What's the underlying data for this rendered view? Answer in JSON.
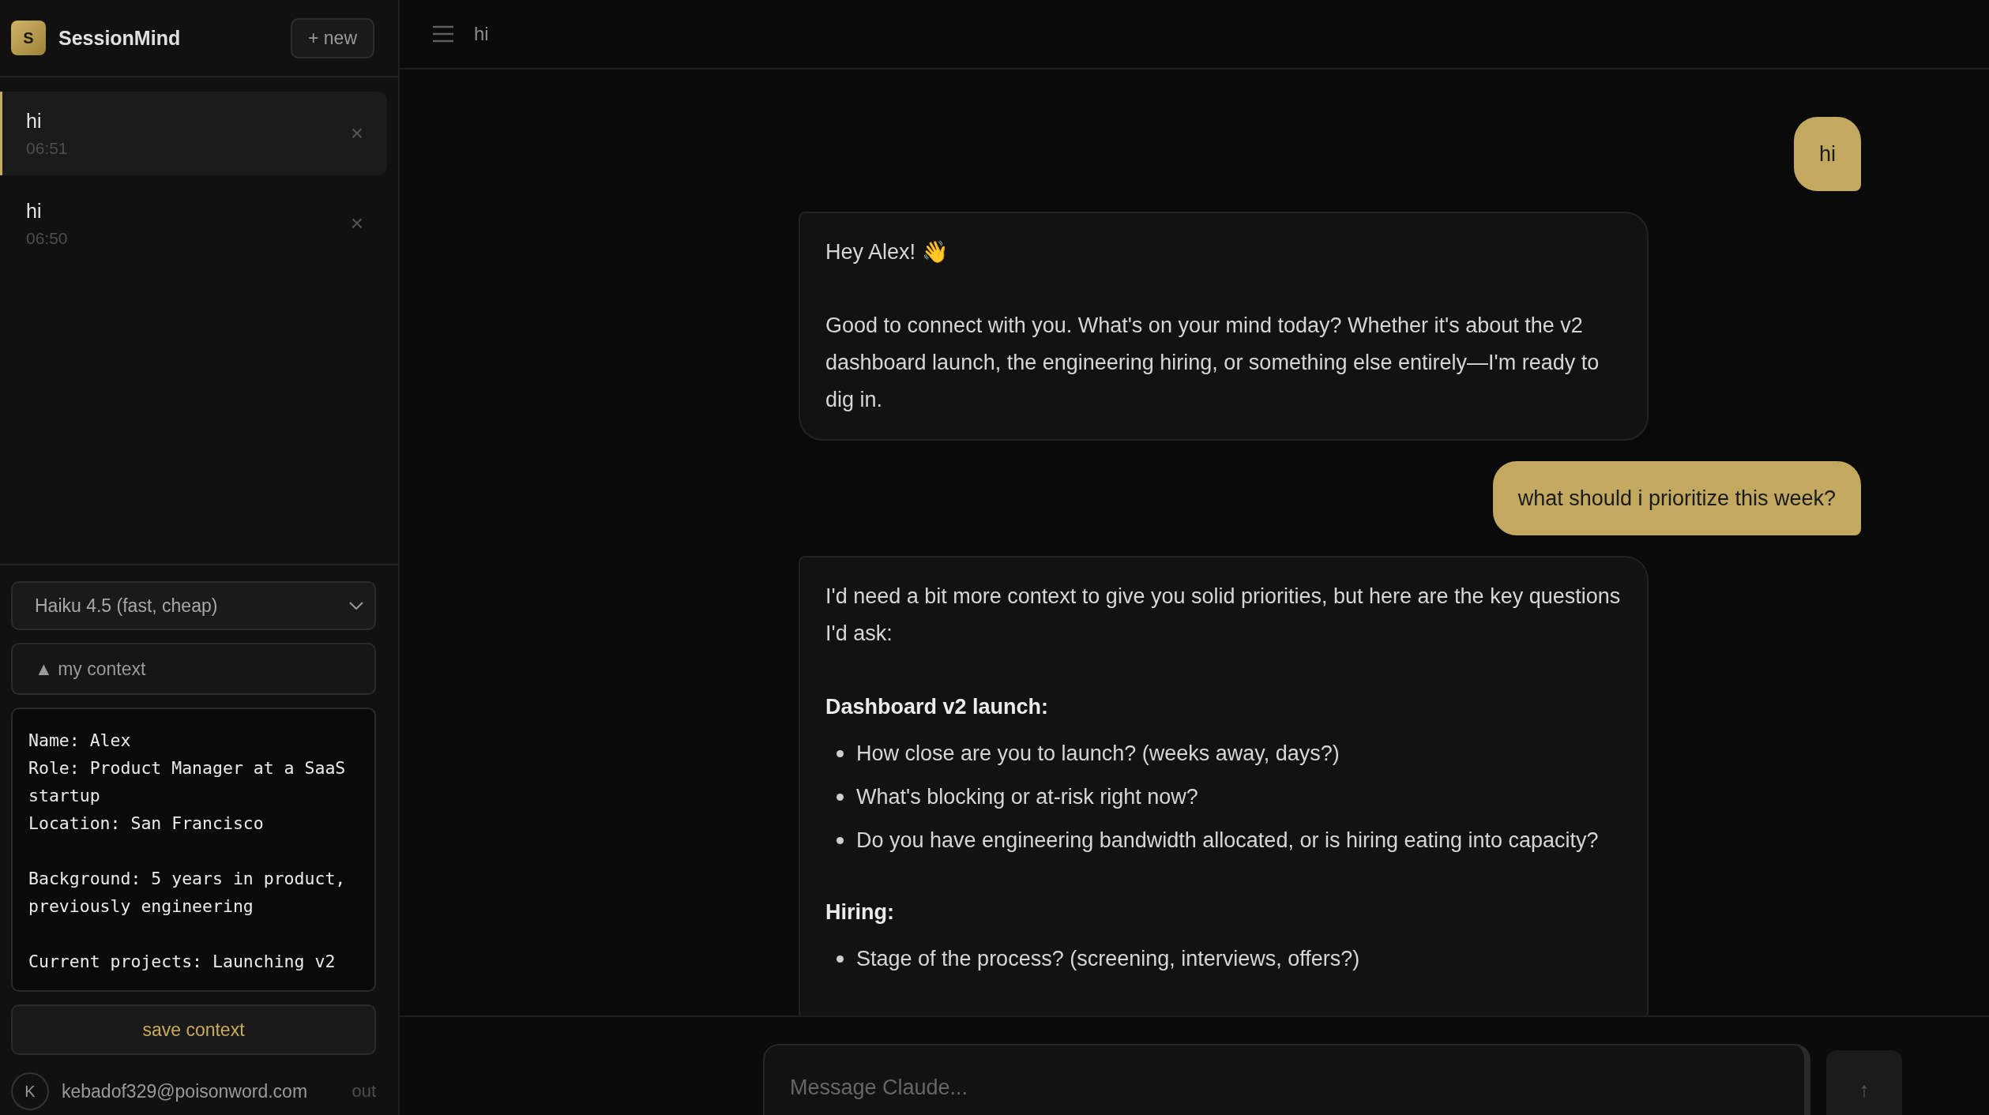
{
  "app": {
    "logo_letter": "S",
    "name": "SessionMind",
    "new_button": "+ new"
  },
  "sessions": [
    {
      "title": "hi",
      "time": "06:51",
      "selected": true,
      "close": "×"
    },
    {
      "title": "hi",
      "time": "06:50",
      "selected": false,
      "close": "×"
    }
  ],
  "model_select": {
    "value": "Haiku 4.5 (fast, cheap)"
  },
  "context_toggle": {
    "icon": "▲",
    "label": "my context"
  },
  "context_text": "Name: Alex\nRole: Product Manager at a SaaS startup\nLocation: San Francisco\n\nBackground: 5 years in product, previously engineering\n\nCurrent projects: Launching v2",
  "save_button": "save context",
  "account": {
    "initial": "K",
    "email": "kebadof329@poisonword.com",
    "sign_out": "out"
  },
  "header": {
    "title": "hi"
  },
  "messages": [
    {
      "kind": "user",
      "text": "hi"
    },
    {
      "kind": "assistant",
      "blocks": [
        {
          "kind": "paragraph",
          "text": "Hey Alex! 👋"
        },
        {
          "kind": "paragraph",
          "text": "Good to connect with you. What's on your mind today? Whether it's about the v2 dashboard launch, the engineering hiring, or something else entirely—I'm ready to dig in."
        }
      ]
    },
    {
      "kind": "user",
      "text": "what should i prioritize this week?"
    },
    {
      "kind": "assistant",
      "blocks": [
        {
          "kind": "paragraph",
          "text": "I'd need a bit more context to give you solid priorities, but here are the key questions I'd ask:"
        },
        {
          "kind": "heading",
          "text": "Dashboard v2 launch:"
        },
        {
          "kind": "bullets",
          "items": [
            "How close are you to launch? (weeks away, days?)",
            "What's blocking or at-risk right now?",
            "Do you have engineering bandwidth allocated, or is hiring eating into capacity?"
          ]
        },
        {
          "kind": "heading",
          "text": "Hiring:"
        },
        {
          "kind": "bullets",
          "items": [
            "Stage of the process? (screening, interviews, offers?)"
          ]
        }
      ]
    }
  ],
  "composer": {
    "placeholder": "Message Claude...",
    "send": "↑"
  }
}
